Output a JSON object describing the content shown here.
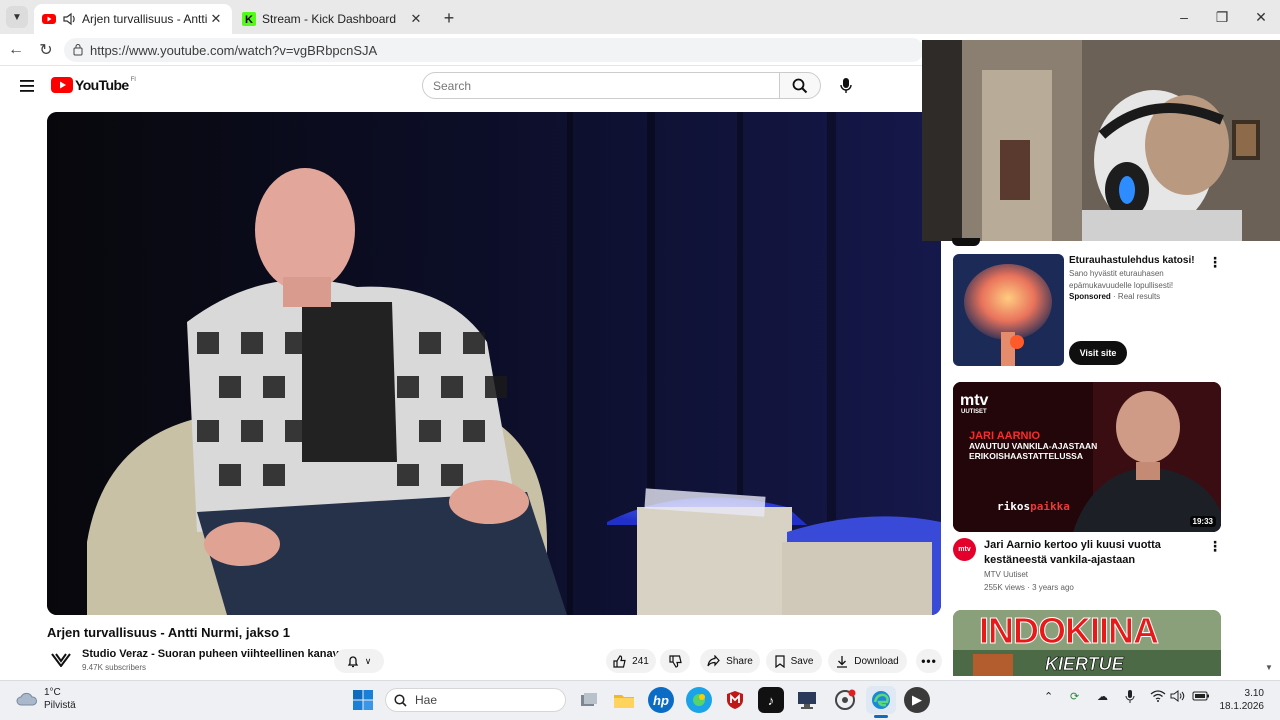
{
  "browser": {
    "tabs": [
      {
        "label": "Arjen turvallisuus - Antti Nurmi",
        "active": true
      },
      {
        "label": "Stream - Kick Dashboard",
        "active": false
      }
    ],
    "url": "https://www.youtube.com/watch?v=vgBRbpcnSJA"
  },
  "youtube": {
    "logo_text": "YouTube",
    "region": "FI",
    "search_placeholder": "Search",
    "video": {
      "title": "Arjen turvallisuus - Antti Nurmi, jakso 1",
      "channel": "Studio Veraz - Suoran puheen viihteellinen kanava",
      "subscribers": "9.47K subscribers",
      "likes": "241",
      "share_label": "Share",
      "save_label": "Save",
      "download_label": "Download"
    },
    "sidebar": {
      "ad": {
        "title": "Eturauhastulehdus katosi!",
        "description": "Sano hyvästit eturauhasen epämukavuudelle lopullisesti!",
        "sponsored": "Sponsored",
        "source": "Real results",
        "cta": "Visit site"
      },
      "videos": [
        {
          "title": "Jari Aarnio kertoo yli kuusi vuotta kestäneestä vankila-ajastaan",
          "channel": "MTV Uutiset",
          "views": "255K views",
          "age": "3 years ago",
          "duration": "19:33",
          "thumb_logo": "mtv",
          "thumb_logo_sub": "UUTISET",
          "thumb_line1": "JARI AARNIO",
          "thumb_line2": "AVAUTUU VANKILA-AJASTAAN",
          "thumb_line3": "ERIKOISHAASTATTELUSSA",
          "thumb_brand_a": "rikos",
          "thumb_brand_b": "paikka"
        },
        {
          "thumb_line1": "INDOKIINA",
          "thumb_line2": "KIERTUE"
        }
      ]
    }
  },
  "taskbar": {
    "search_placeholder": "Hae",
    "weather_temp": "1°C",
    "weather_desc": "Pilvistä",
    "time": "3.10",
    "date": "18.1.2026"
  },
  "colors": {
    "yt_red": "#ff0000",
    "kick_green": "#53fc18",
    "taskbar_bg": "#eef0f3"
  }
}
